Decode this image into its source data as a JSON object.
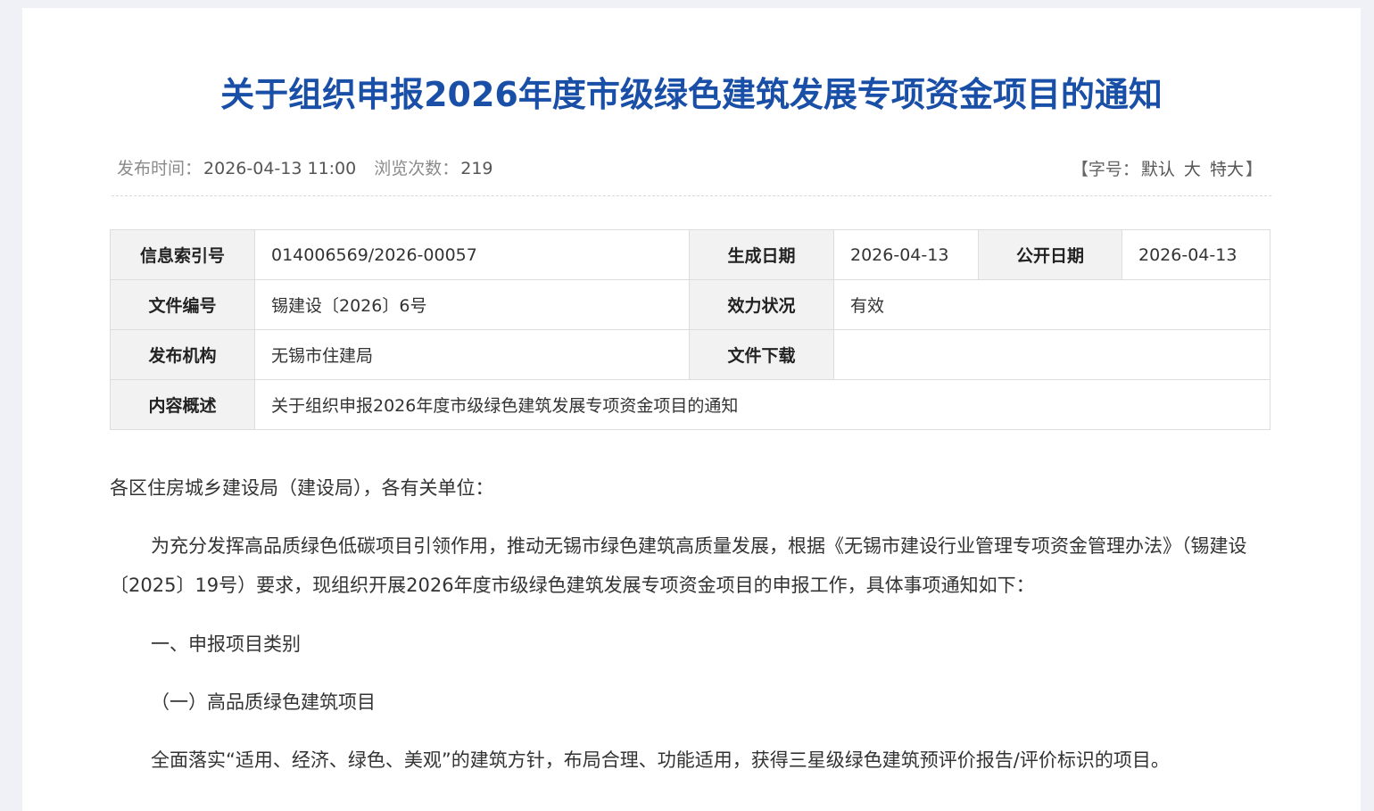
{
  "article": {
    "title": "关于组织申报2026年度市级绿色建筑发展专项资金项目的通知",
    "meta": {
      "publish_label": "发布时间：",
      "publish_value": "2026-04-13 11:00",
      "views_label": "浏览次数：",
      "views_value": "219"
    },
    "font_size": {
      "prefix": "【字号：",
      "default": "默认",
      "large": "大",
      "xlarge": "特大",
      "suffix": "】"
    }
  },
  "info_table": {
    "index_label": "信息索引号",
    "index_value": "014006569/2026-00057",
    "created_label": "生成日期",
    "created_value": "2026-04-13",
    "public_label": "公开日期",
    "public_value": "2026-04-13",
    "docno_label": "文件编号",
    "docno_value": "锡建设〔2026〕6号",
    "status_label": "效力状况",
    "status_value": "有效",
    "org_label": "发布机构",
    "org_value": "无锡市住建局",
    "download_label": "文件下载",
    "summary_label": "内容概述",
    "summary_value": "关于组织申报2026年度市级绿色建筑发展专项资金项目的通知"
  },
  "body": {
    "salutation": "各区住房城乡建设局（建设局），各有关单位：",
    "para1": "为充分发挥高品质绿色低碳项目引领作用，推动无锡市绿色建筑高质量发展，根据《无锡市建设行业管理专项资金管理办法》（锡建设〔2025〕19号）要求，现组织开展2026年度市级绿色建筑发展专项资金项目的申报工作，具体事项通知如下：",
    "heading1": "一、申报项目类别",
    "heading2": "（一）高品质绿色建筑项目",
    "para2": "全面落实“适用、经济、绿色、美观”的建筑方针，布局合理、功能适用，获得三星级绿色建筑预评价报告/评价标识的项目。"
  }
}
